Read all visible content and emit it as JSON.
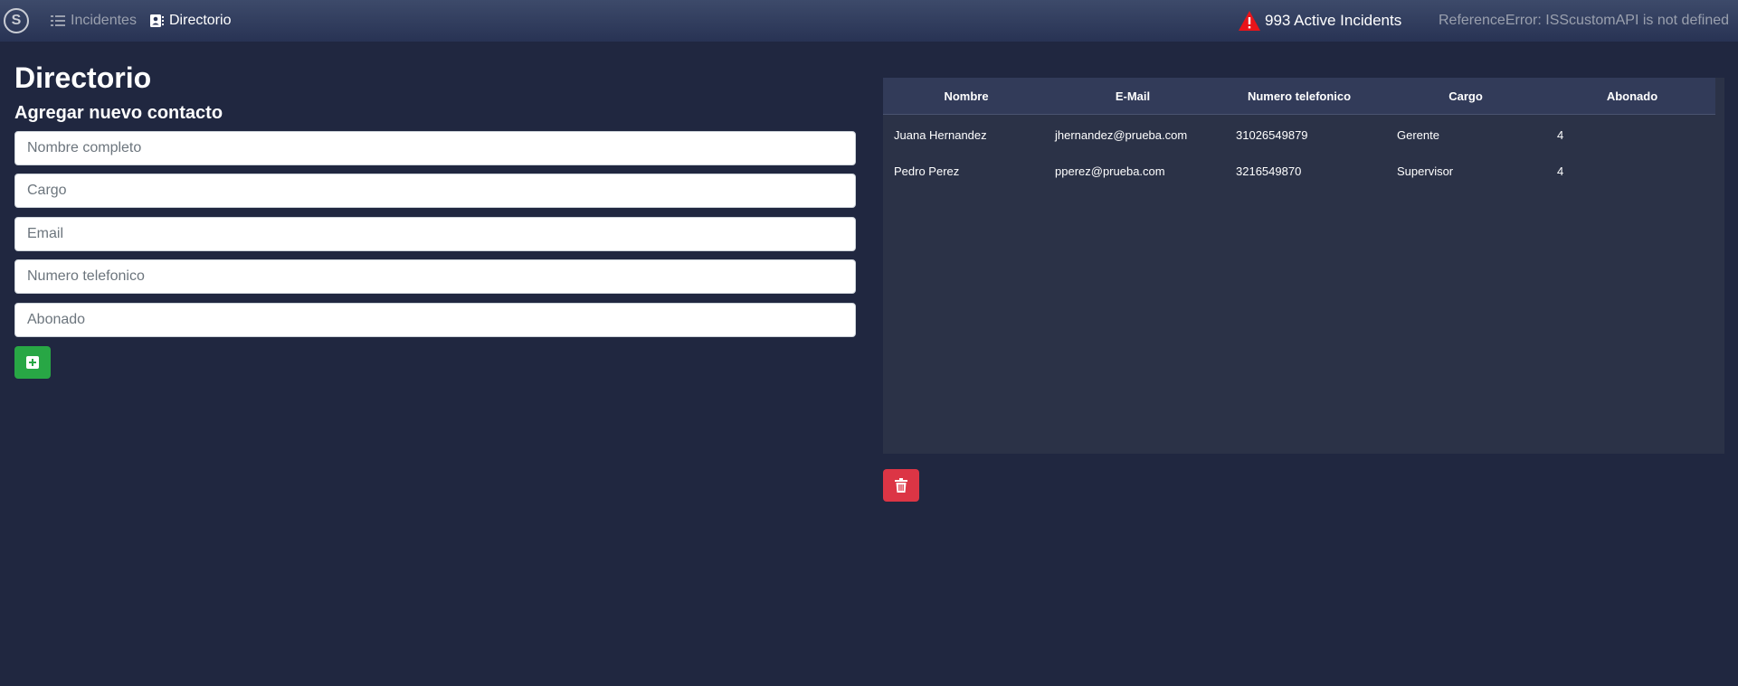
{
  "navbar": {
    "brand_letter": "S",
    "links": [
      {
        "label": "Incidentes",
        "icon": "list-icon",
        "active": false
      },
      {
        "label": "Directorio",
        "icon": "contact-card-icon",
        "active": true
      }
    ],
    "alert_text": "993 Active Incidents",
    "alert_icon": "warning-triangle-icon",
    "alert_color": "#e8141a",
    "error_text": "ReferenceError: ISScustomAPI is not defined"
  },
  "page": {
    "title": "Directorio",
    "section_title": "Agregar nuevo contacto"
  },
  "form": {
    "fields": [
      {
        "placeholder": "Nombre completo",
        "value": ""
      },
      {
        "placeholder": "Cargo",
        "value": ""
      },
      {
        "placeholder": "Email",
        "value": ""
      },
      {
        "placeholder": "Numero telefonico",
        "value": ""
      },
      {
        "placeholder": "Abonado",
        "value": ""
      }
    ],
    "add_button_icon": "plus-square-icon",
    "add_button_color": "#28a745"
  },
  "table": {
    "columns": [
      "Nombre",
      "E-Mail",
      "Numero telefonico",
      "Cargo",
      "Abonado"
    ],
    "rows": [
      [
        "Juana Hernandez",
        "jhernandez@prueba.com",
        "31026549879",
        "Gerente",
        "4"
      ],
      [
        "Pedro Perez",
        "pperez@prueba.com",
        "3216549870",
        "Supervisor",
        "4"
      ]
    ]
  },
  "delete_button": {
    "icon": "trash-icon",
    "color": "#dc3545"
  }
}
